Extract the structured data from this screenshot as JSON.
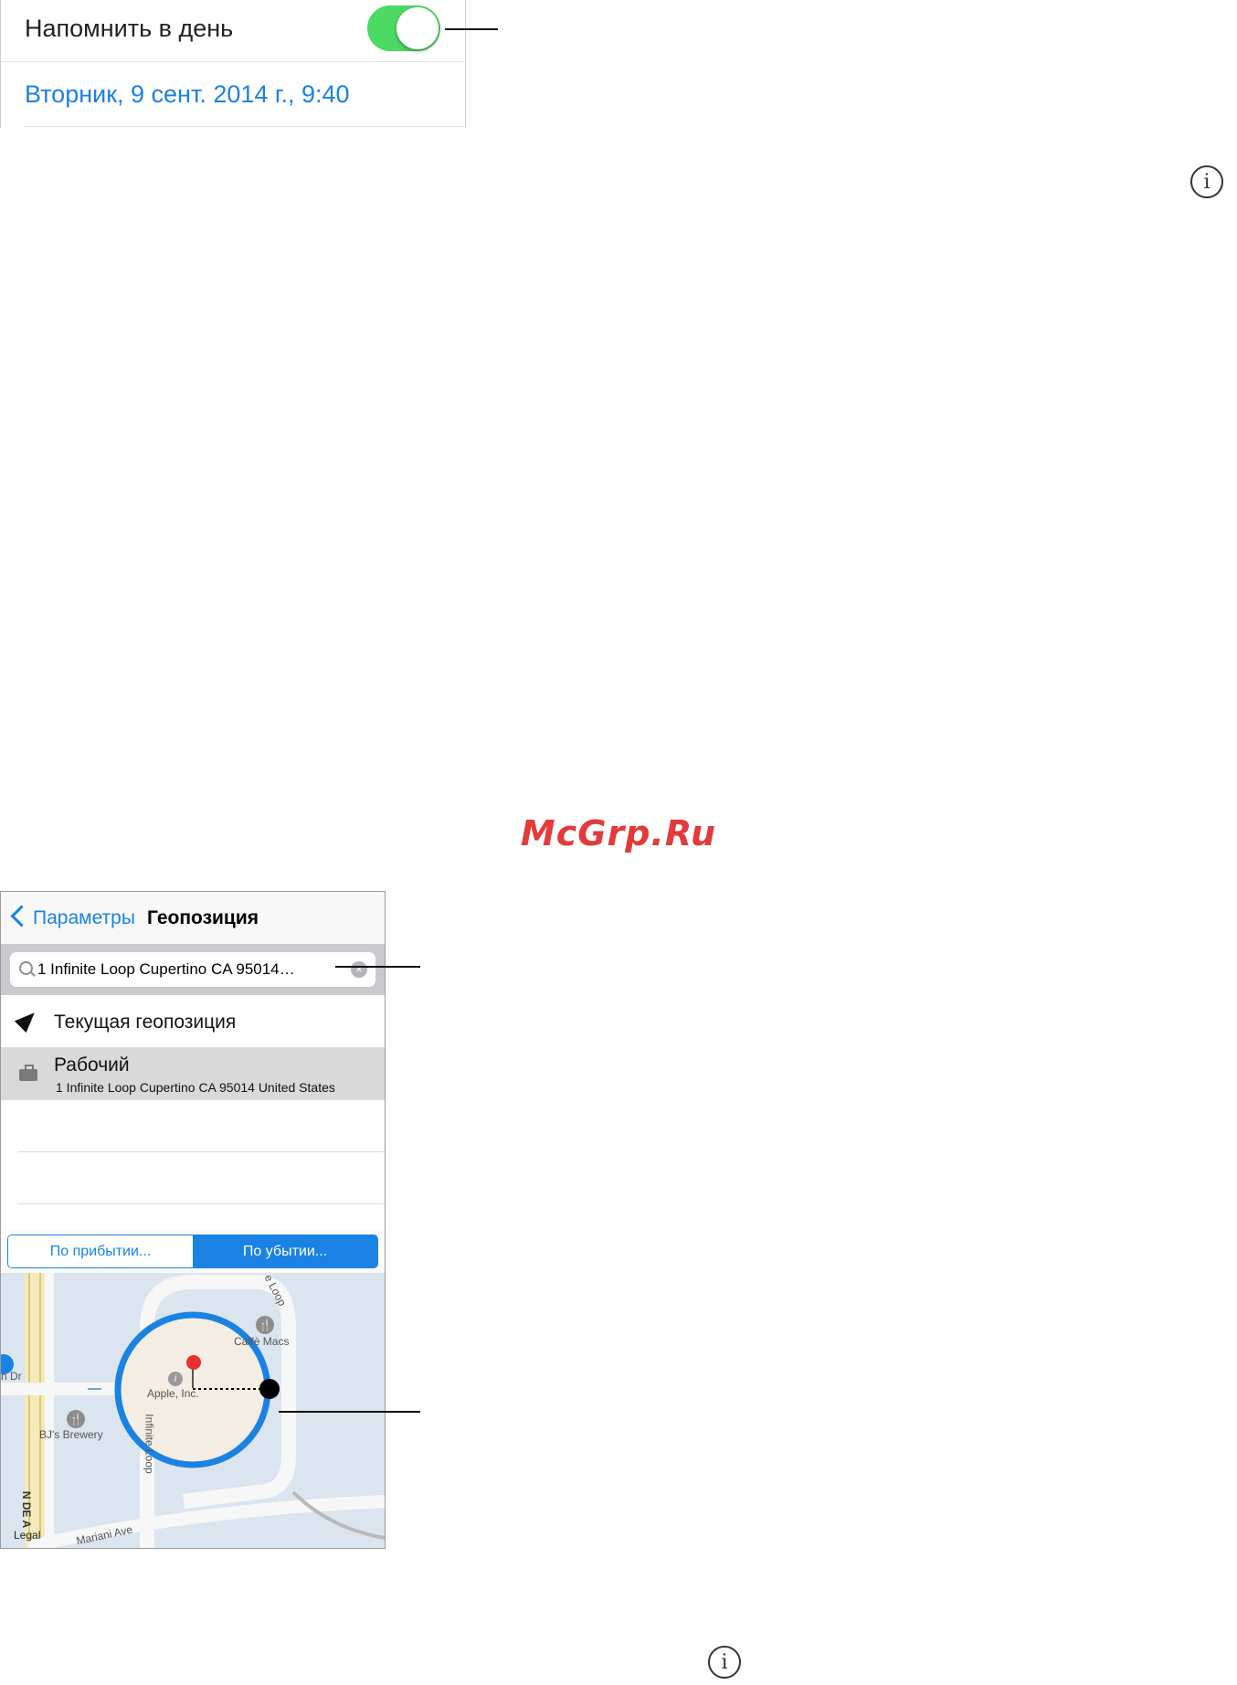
{
  "reminder": {
    "remind_day_label": "Напомнить в день",
    "remind_day_enabled": true,
    "date_value": "Вторник, 9 сент. 2014 г., 9:40"
  },
  "icons": {
    "info_glyph": "i"
  },
  "watermark": "McGrp.Ru",
  "location_screen": {
    "back_label": "Параметры",
    "title": "Геопозиция",
    "search": {
      "value": "1 Infinite Loop Cupertino CA 95014…"
    },
    "current_location_label": "Текущая геопозиция",
    "work": {
      "label": "Рабочий",
      "address": "1 Infinite Loop Cupertino CA 95014 United States"
    },
    "segmented": {
      "arrive": "По прибытии...",
      "leave": "По убытии...",
      "selected": "leave"
    },
    "map": {
      "labels": {
        "caffe": "Caffè Macs",
        "apple": "Apple, Inc.",
        "brewery": "BJ's Brewery",
        "infinite_loop_1": "Infinite Loop",
        "infinite_loop_2": "e Loop",
        "mariani": "Mariani Ave",
        "n_de_anza": "N DE A",
        "legal": "Legal",
        "dr": "n Dr"
      }
    }
  },
  "colors": {
    "ios_blue": "#1a82e2",
    "toggle_green": "#4cd964",
    "watermark_red": "#e33a3a",
    "pin_red": "#e7302a"
  }
}
